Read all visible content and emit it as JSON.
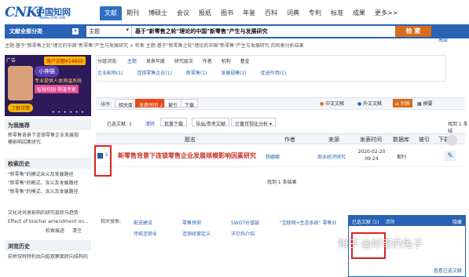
{
  "logo": {
    "brand": "CNKI",
    "cn": "中国知网",
    "url": "www.cnki.net"
  },
  "nav": {
    "tabs": [
      "文献",
      "期刊",
      "博硕士",
      "会议",
      "报纸",
      "图书",
      "年鉴",
      "百科",
      "词典",
      "专利",
      "标准",
      "成果",
      "更多>>"
    ],
    "active": "文献"
  },
  "search": {
    "scope": "文献全部分类",
    "field": "主题",
    "query": "基于\"新零售之轮\"理论的中国\"新零售\"产生与发展研究",
    "button": "检 索",
    "adv1": "结果中检索",
    "adv2": "高级"
  },
  "breadcrumb": "主题:基于\"新零售之轮\"理论的中国\"新零售\"产生与发展研究 × 检索 主题:基于\"新零售之轮\"理论的中国\"新零售\"产生与发展研究 的检索分析结果",
  "ad": {
    "tag": "广告",
    "coupon": "账户余额¥14600",
    "bubble": "小神猫",
    "line1": "专业提供人体测温系统",
    "line2": "智慧校园 筛温专家",
    "button": "了解详情",
    "dots": "• • • • • •"
  },
  "left": {
    "recommend_title": "为我推荐",
    "recommend_items": [
      "新零售背景下连锁零售企业发展规",
      "模影响因素研究"
    ],
    "history_title": "检索历史",
    "history_items": [
      "\"新零售\"的模式含义及发展路径",
      "\"新零售\"的概式、含义及发展路径",
      "\"新零售\"的模式、含义及发展路径",
      "文化对共享影响的研究现状与趋势",
      "Effect of biochar amendment on..."
    ],
    "history_more": "检索痕迹",
    "history_clear": "清空",
    "browse_title": "浏览历史",
    "browse_items": [
      "前桥馆特特利共向乾观察面转向结构的"
    ]
  },
  "group": {
    "label": "分组浏览:",
    "items": [
      "主题",
      "发表年度",
      "研究层次",
      "作者",
      "机构",
      "基金"
    ],
    "active": "主题",
    "sub": [
      "企业影响(1)",
      "连锁零售企业(1)",
      "新零售(1)",
      "发展规模(1)",
      "促进作用(1)"
    ]
  },
  "sort": {
    "label": "排序:",
    "relevance": "相关度",
    "time": "发表时间 ↓",
    "cited": "被引",
    "downloads": "下载",
    "lang_cn": "中文文献",
    "lang_en": "外文文献",
    "view_list": "列表",
    "view_detail": "摘要"
  },
  "selection": {
    "label": "已选文献:",
    "count": "1",
    "clear": "清除",
    "batch": "批量下载",
    "export": "导出/参考文献",
    "analyze": "计量可视化分析 ▾",
    "found_top": "找到 1 条结"
  },
  "table": {
    "headers": [
      "题名",
      "作者",
      "来源",
      "发表时间",
      "数据库",
      "被引",
      "下载"
    ],
    "rows": [
      {
        "index": "1",
        "title": "新零售背景下连锁零售企业发展规模影响因素研究",
        "author": "杨娜娜",
        "source": "商业经济研究",
        "date": "2020-02-20",
        "time": "09:24",
        "db": "期刊"
      }
    ]
  },
  "found": "找到 1 条结果",
  "related": {
    "label": "相关搜索:",
    "items": [
      "配送建设",
      "零售预测",
      "SWOT价值链",
      "\"互联网+生态系统\" 零售业",
      "传统连锁业",
      "连锁经营定义",
      "沃尔玛介绍"
    ]
  },
  "selpop": {
    "title": "已选文献",
    "count": "(1)",
    "clear": "清除",
    "close": "隐藏",
    "footer": "查看已选文献"
  },
  "watermark": "知乎 @好奇的兔子",
  "right": {
    "page": "找到 1"
  }
}
